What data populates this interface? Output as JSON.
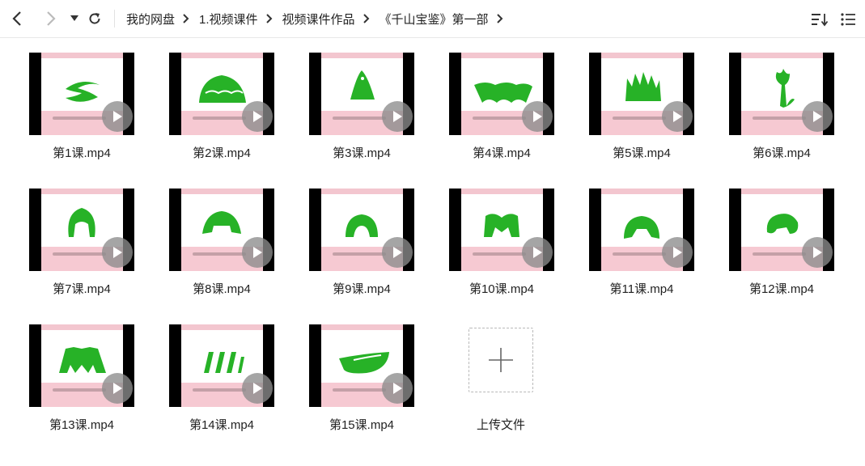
{
  "toolbar": {
    "back_icon": "chevron-left-icon",
    "forward_icon": "chevron-right-icon",
    "history_icon": "triangle-down-icon",
    "refresh_icon": "refresh-icon",
    "sort_icon": "sort-icon",
    "view_icon": "list-view-icon"
  },
  "breadcrumb": [
    "我的网盘",
    "1.视频课件",
    "视频课件作品",
    "《千山宝鉴》第一部"
  ],
  "files": [
    {
      "name": "第1课.mp4",
      "shape": "swirl"
    },
    {
      "name": "第2课.mp4",
      "shape": "dome"
    },
    {
      "name": "第3课.mp4",
      "shape": "hill"
    },
    {
      "name": "第4课.mp4",
      "shape": "wave"
    },
    {
      "name": "第5课.mp4",
      "shape": "grass"
    },
    {
      "name": "第6课.mp4",
      "shape": "tree"
    },
    {
      "name": "第7课.mp4",
      "shape": "head"
    },
    {
      "name": "第8课.mp4",
      "shape": "hat"
    },
    {
      "name": "第9课.mp4",
      "shape": "arch"
    },
    {
      "name": "第10课.mp4",
      "shape": "m"
    },
    {
      "name": "第11课.mp4",
      "shape": "bell"
    },
    {
      "name": "第12课.mp4",
      "shape": "blob"
    },
    {
      "name": "第13课.mp4",
      "shape": "crown"
    },
    {
      "name": "第14课.mp4",
      "shape": "bars"
    },
    {
      "name": "第15课.mp4",
      "shape": "bowl"
    }
  ],
  "upload": {
    "label": "上传文件",
    "icon": "plus-icon"
  },
  "colors": {
    "green": "#27b227",
    "pink": "#f6c9d2"
  }
}
